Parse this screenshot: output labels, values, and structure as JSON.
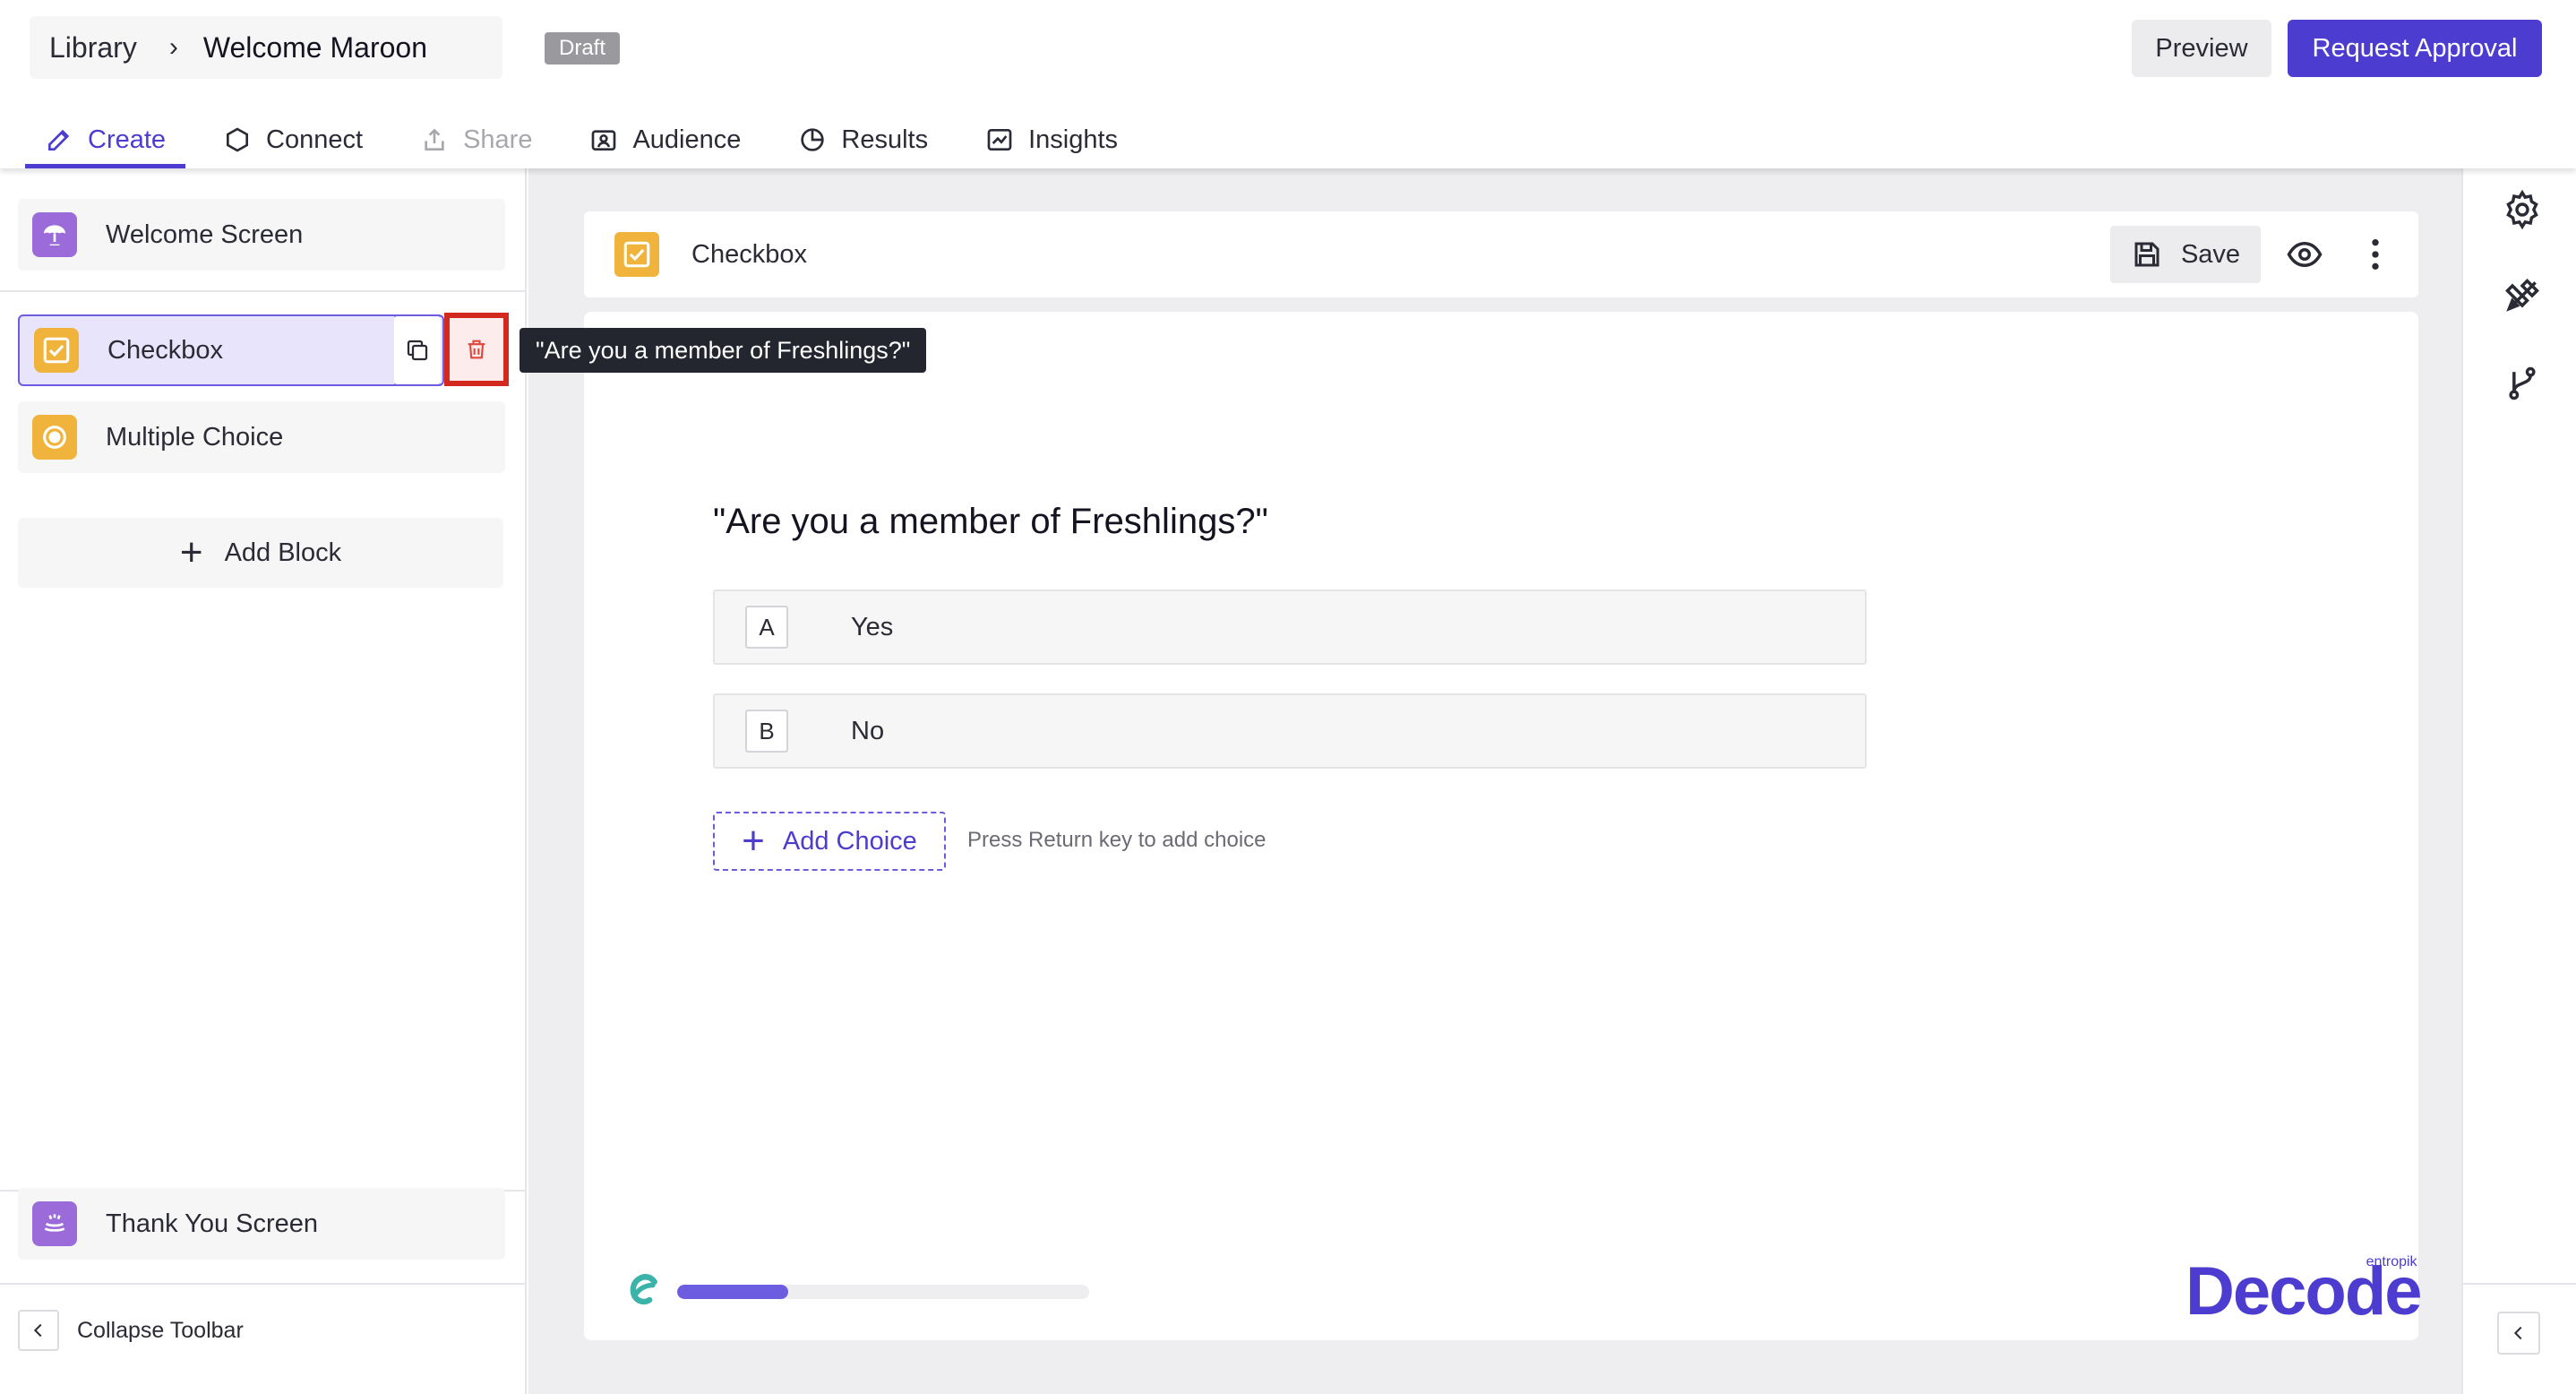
{
  "header": {
    "breadcrumb_root": "Library",
    "breadcrumb_sep": "›",
    "breadcrumb_current": "Welcome Maroon",
    "status_badge": "Draft",
    "preview_label": "Preview",
    "request_label": "Request Approval"
  },
  "tabs": [
    {
      "label": "Create",
      "icon": "pencil-icon",
      "active": true
    },
    {
      "label": "Connect",
      "icon": "hexagon-icon"
    },
    {
      "label": "Share",
      "icon": "share-icon",
      "disabled": true
    },
    {
      "label": "Audience",
      "icon": "audience-icon"
    },
    {
      "label": "Results",
      "icon": "pie-chart-icon"
    },
    {
      "label": "Insights",
      "icon": "insights-icon"
    }
  ],
  "sidebar": {
    "blocks": [
      {
        "label": "Welcome Screen",
        "icon": "welcome-icon",
        "color": "#9b6bd9"
      },
      {
        "label": "Checkbox",
        "icon": "checkbox-icon",
        "color": "#f0b43c",
        "selected": true
      },
      {
        "label": "Multiple Choice",
        "icon": "radio-icon",
        "color": "#f0b43c"
      },
      {
        "label": "Thank You Screen",
        "icon": "thank-you-icon",
        "color": "#9b6bd9"
      }
    ],
    "add_block_label": "Add Block",
    "collapse_label": "Collapse Toolbar"
  },
  "tooltip": "\"Are you a member of Freshlings?\"",
  "editor": {
    "block_title": "Checkbox",
    "save_label": "Save",
    "question": "\"Are you a member of Freshlings?\"",
    "choices": [
      {
        "key": "A",
        "text": "Yes"
      },
      {
        "key": "B",
        "text": "No"
      }
    ],
    "add_choice_label": "Add Choice",
    "hint": "Press Return key to add choice",
    "progress_fraction": 0.27,
    "brand_name": "Decode",
    "brand_sub": "entropik"
  },
  "colors": {
    "accent": "#4c3ccf",
    "danger": "#d2281e",
    "block_yellow": "#f0b43c",
    "block_purple": "#9b6bd9"
  }
}
